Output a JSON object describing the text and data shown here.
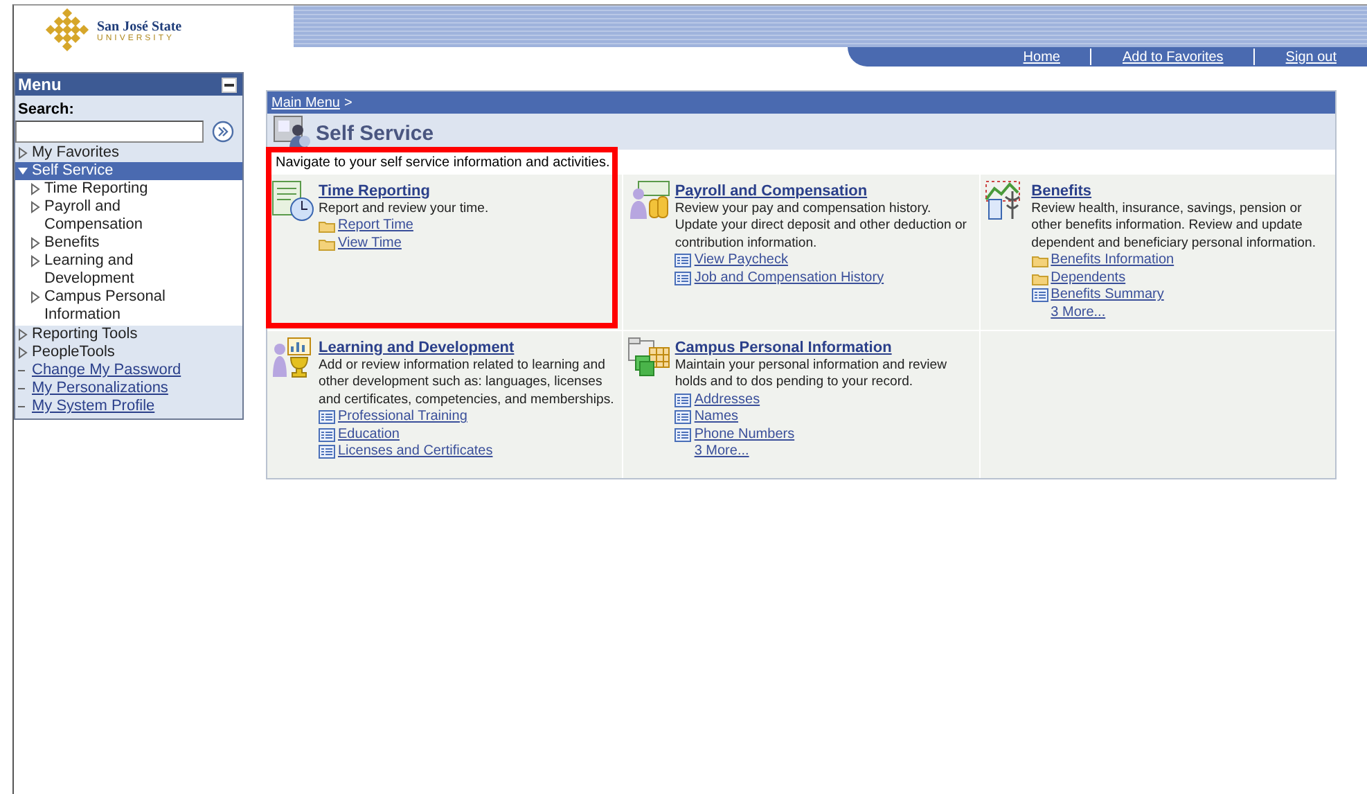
{
  "logo": {
    "name": "San José State",
    "sub": "UNIVERSITY"
  },
  "header_links": [
    "Home",
    "Add to Favorites",
    "Sign out"
  ],
  "menu": {
    "title": "Menu",
    "search_label": "Search:",
    "items": [
      {
        "label": "My Favorites",
        "kind": "folder",
        "expanded": false,
        "selected": false
      },
      {
        "label": "Self Service",
        "kind": "folder",
        "expanded": true,
        "selected": true,
        "children": [
          {
            "label": "Time Reporting",
            "kind": "folder",
            "expanded": false,
            "selected": false
          },
          {
            "label": "Payroll and Compensation",
            "kind": "folder",
            "expanded": false,
            "selected": false
          },
          {
            "label": "Benefits",
            "kind": "folder",
            "expanded": false,
            "selected": false
          },
          {
            "label": "Learning and Development",
            "kind": "folder",
            "expanded": false,
            "selected": false
          },
          {
            "label": "Campus Personal Information",
            "kind": "folder",
            "expanded": false,
            "selected": false
          }
        ]
      },
      {
        "label": "Reporting Tools",
        "kind": "folder",
        "expanded": false,
        "selected": false
      },
      {
        "label": "PeopleTools",
        "kind": "folder",
        "expanded": false,
        "selected": false
      },
      {
        "label": "Change My Password",
        "kind": "link",
        "selected": false
      },
      {
        "label": "My Personalizations",
        "kind": "link",
        "selected": false
      },
      {
        "label": "My System Profile",
        "kind": "link",
        "selected": false
      }
    ]
  },
  "breadcrumb": {
    "link": "Main Menu",
    "separator": ">"
  },
  "page_title": "Self Service",
  "intro": "Navigate to your self service information and activities.",
  "cards": [
    {
      "title": "Time Reporting",
      "highlighted": true,
      "description": "Report and review your time.",
      "links": [
        {
          "label": "Report Time",
          "kind": "folder"
        },
        {
          "label": "View Time",
          "kind": "folder"
        }
      ]
    },
    {
      "title": "Payroll and Compensation",
      "highlighted": false,
      "description": "Review your pay and compensation history. Update your direct deposit and other deduction or contribution information.",
      "links": [
        {
          "label": "View Paycheck",
          "kind": "page"
        },
        {
          "label": "Job and Compensation History",
          "kind": "page"
        }
      ]
    },
    {
      "title": "Benefits",
      "highlighted": false,
      "description": "Review health, insurance, savings, pension or other benefits information. Review and update dependent and beneficiary personal information.",
      "links": [
        {
          "label": "Benefits Information",
          "kind": "folder"
        },
        {
          "label": "Dependents",
          "kind": "folder"
        },
        {
          "label": "Benefits Summary",
          "kind": "page"
        },
        {
          "label": "3 More...",
          "kind": "more"
        }
      ]
    },
    {
      "title": "Learning and Development",
      "highlighted": false,
      "description": "Add or review information related to learning and other development such as: languages, licenses and certificates, competencies, and memberships.",
      "links": [
        {
          "label": "Professional Training",
          "kind": "page"
        },
        {
          "label": "Education",
          "kind": "page"
        },
        {
          "label": "Licenses and Certificates",
          "kind": "page"
        }
      ]
    },
    {
      "title": "Campus Personal Information",
      "highlighted": false,
      "description": "Maintain your personal information and review holds and to dos pending to your record.",
      "links": [
        {
          "label": "Addresses",
          "kind": "page"
        },
        {
          "label": "Names",
          "kind": "page"
        },
        {
          "label": "Phone Numbers",
          "kind": "page"
        },
        {
          "label": "3 More...",
          "kind": "more"
        }
      ]
    }
  ]
}
